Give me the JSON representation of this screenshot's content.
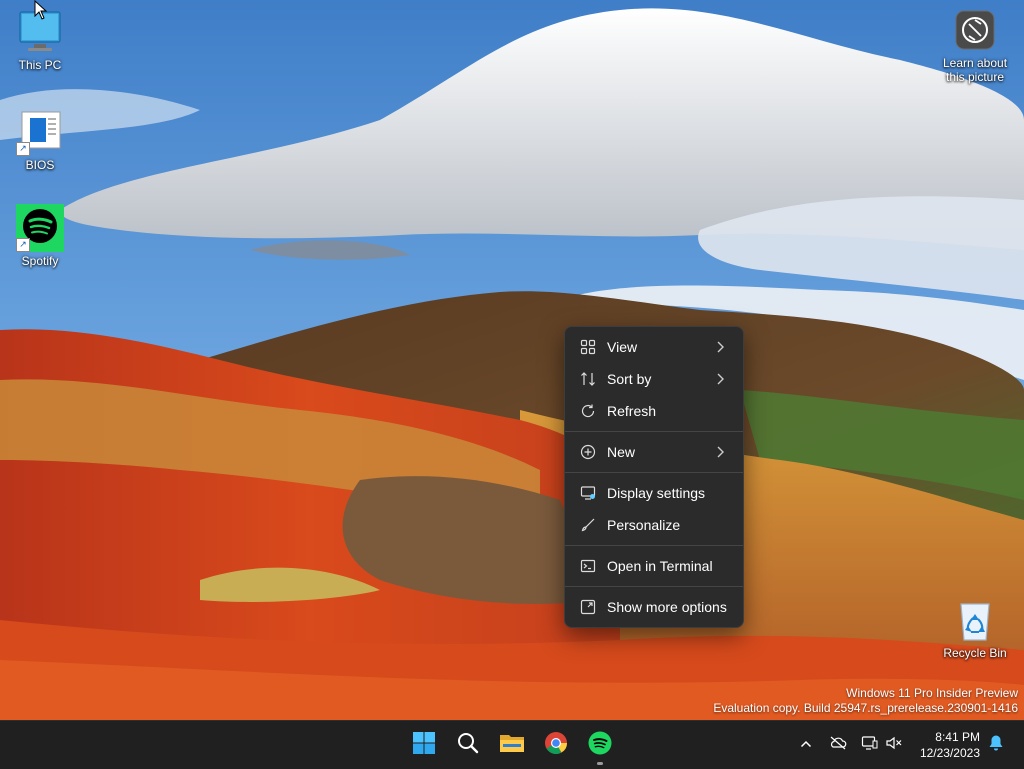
{
  "desktop": {
    "icons": [
      {
        "label": "This PC",
        "icon": "monitor-icon"
      },
      {
        "label": "BIOS",
        "icon": "document-icon"
      },
      {
        "label": "Spotify",
        "icon": "spotify-icon"
      },
      {
        "label": "Recycle Bin",
        "icon": "recycle-bin-icon"
      }
    ],
    "spotlight": {
      "line1": "Learn about",
      "line2": "this picture",
      "icon": "camera-icon"
    }
  },
  "context_menu": {
    "items": [
      {
        "label": "View",
        "icon": "grid-icon",
        "submenu": true
      },
      {
        "label": "Sort by",
        "icon": "sort-icon",
        "submenu": true
      },
      {
        "label": "Refresh",
        "icon": "refresh-icon",
        "submenu": false
      },
      {
        "label": "New",
        "icon": "plus-circle-icon",
        "submenu": true
      },
      {
        "label": "Display settings",
        "icon": "display-icon",
        "submenu": false
      },
      {
        "label": "Personalize",
        "icon": "brush-icon",
        "submenu": false
      },
      {
        "label": "Open in Terminal",
        "icon": "terminal-icon",
        "submenu": false
      },
      {
        "label": "Show more options",
        "icon": "expand-icon",
        "submenu": false
      }
    ]
  },
  "watermark": {
    "line1": "Windows 11 Pro Insider Preview",
    "line2": "Evaluation copy. Build 25947.rs_prerelease.230901-1416"
  },
  "taskbar": {
    "apps": [
      {
        "name": "Start",
        "icon": "windows-start-icon"
      },
      {
        "name": "Search",
        "icon": "search-icon"
      },
      {
        "name": "File Explorer",
        "icon": "folder-icon"
      },
      {
        "name": "Google Chrome",
        "icon": "chrome-icon"
      },
      {
        "name": "Spotify",
        "icon": "spotify-icon",
        "running": true
      }
    ],
    "tray": {
      "icons": [
        "chevron-up-icon",
        "network-cloud-icon",
        "display-tray-icon",
        "volume-muted-icon",
        "notification-bell-icon"
      ]
    },
    "clock": {
      "time": "8:41 PM",
      "date": "12/23/2023"
    }
  },
  "colors": {
    "accent": "#60cdff",
    "menu_bg": "#2b2b2b",
    "taskbar_bg": "#202020",
    "spotify": "#1ed760"
  }
}
